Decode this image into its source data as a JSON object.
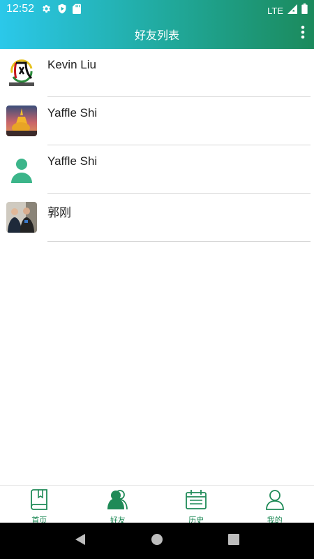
{
  "status_bar": {
    "time": "12:52",
    "network": "LTE",
    "left_icons": [
      "gear-icon",
      "play-shield-icon",
      "sd-card-icon"
    ],
    "right_icons": [
      "signal-icon",
      "battery-icon"
    ]
  },
  "header": {
    "title": "好友列表",
    "menu_icon": "overflow-menu-icon"
  },
  "friends": [
    {
      "name": "Kevin Liu",
      "avatar": "calligraphy-logo"
    },
    {
      "name": "Yaffle Shi",
      "avatar": "golden-temple-photo"
    },
    {
      "name": "Yaffle Shi",
      "avatar": "default-person-icon"
    },
    {
      "name": "郭刚",
      "avatar": "people-photo"
    }
  ],
  "bottom_nav": {
    "items": [
      {
        "label": "首页",
        "icon": "book-icon",
        "active": false
      },
      {
        "label": "好友",
        "icon": "friends-icon",
        "active": true
      },
      {
        "label": "历史",
        "icon": "calendar-icon",
        "active": false
      },
      {
        "label": "我的",
        "icon": "profile-icon",
        "active": false
      }
    ]
  },
  "colors": {
    "header_start": "#2bc8ea",
    "header_end": "#1b8a5c",
    "accent_green": "#1f8a57",
    "avatar_green": "#3cb58a"
  }
}
